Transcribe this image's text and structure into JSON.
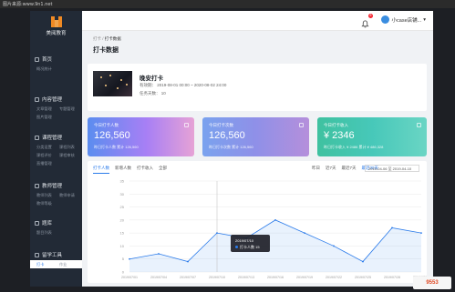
{
  "topbar": {
    "text": "图片来源:www.9n1.net"
  },
  "app": {
    "logo_text": "美阅教育"
  },
  "sidebar": {
    "groups": [
      {
        "head": "首页",
        "rows": [
          [
            "概况统计",
            ""
          ]
        ]
      },
      {
        "head": "内容管理",
        "rows": [
          [
            "文章管理",
            "专题管理"
          ],
          [
            "图片管理",
            ""
          ]
        ]
      },
      {
        "head": "课程管理",
        "rows": [
          [
            "分类设置",
            "课程列表"
          ],
          [
            "课程评价",
            "课程审核"
          ],
          [
            "直播管理",
            ""
          ]
        ]
      },
      {
        "head": "教师管理",
        "rows": [
          [
            "教师列表",
            "教师申请"
          ],
          [
            "教师等级",
            ""
          ]
        ]
      },
      {
        "head": "题库",
        "rows": [
          [
            "题目列表",
            ""
          ]
        ]
      },
      {
        "head": "留学工具",
        "rows": [
          [
            "打卡",
            "作业"
          ]
        ]
      }
    ]
  },
  "header": {
    "badge": "8",
    "username": "小case店铺..."
  },
  "breadcrumb": {
    "parent": "打卡",
    "sep": "/",
    "current": "打卡数据"
  },
  "page": {
    "title": "打卡数据"
  },
  "event": {
    "title": "晚安打卡",
    "time": "有效期： 2019-08-01 00:00 ~ 2020-08-02 24:00",
    "days": "任务天数： 10"
  },
  "stats": [
    {
      "label": "今日打卡人数",
      "value": "126,560",
      "sub": "昨日打卡人数  累计 126,560"
    },
    {
      "label": "今日打卡次数",
      "value": "126,560",
      "sub": "昨日打卡次数  累计 126,560"
    },
    {
      "label": "今日打卡收入",
      "value": "¥ 2346",
      "sub": "昨日打卡收入  ¥ 2486  累计 ¥ 486,328"
    }
  ],
  "chart_tabs": [
    "打卡人数",
    "新增人数",
    "打卡收入",
    "全部"
  ],
  "ranges": [
    "昨日",
    "近7天",
    "最近7天",
    "最近30天"
  ],
  "daterange": "2019-04-06  至  2019-04-10",
  "tooltip": {
    "date": "2019/07/10",
    "value": "打卡人数 15"
  },
  "chart_data": {
    "type": "area",
    "x": [
      "2019/07/01",
      "2019/07/04",
      "2019/07/07",
      "2019/07/10",
      "2019/07/13",
      "2019/07/16",
      "2019/07/19",
      "2019/07/22",
      "2019/07/25",
      "2019/07/28",
      "2019/07/31"
    ],
    "y_ticks": [
      0,
      5,
      10,
      15,
      20,
      25,
      30,
      35
    ],
    "ylim": [
      0,
      35
    ],
    "values": [
      5,
      7,
      4,
      15,
      13,
      20,
      15,
      10,
      4,
      17,
      15
    ],
    "color": "#2b7bea"
  },
  "watermark": "9553"
}
